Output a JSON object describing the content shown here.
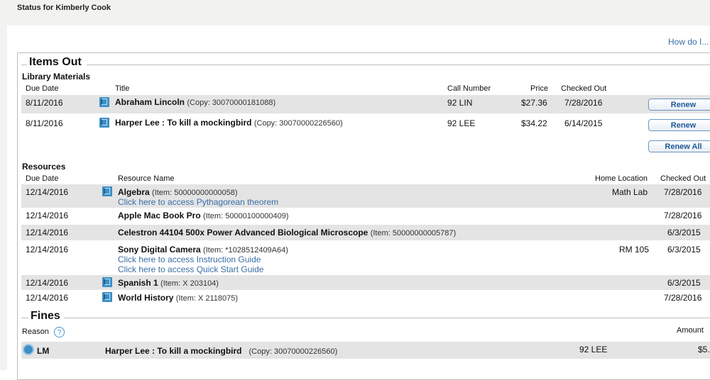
{
  "page": {
    "title": "Status for Kimberly Cook",
    "help_link": "How do I..."
  },
  "items_out": {
    "section_title": "Items Out",
    "subsection": "Library Materials",
    "headers": {
      "due": "Due Date",
      "title": "Title",
      "call": "Call Number",
      "price": "Price",
      "checked": "Checked Out"
    },
    "rows": [
      {
        "due": "8/11/2016",
        "title": "Abraham Lincoln",
        "copy": "(Copy: 30070000181088)",
        "call": "92 LIN",
        "price": "$27.36",
        "checked": "7/28/2016",
        "button": "Renew"
      },
      {
        "due": "8/11/2016",
        "title": "Harper Lee : To kill a mockingbird",
        "copy": "(Copy: 30070000226560)",
        "call": "92 LEE",
        "price": "$34.22",
        "checked": "6/14/2015",
        "button": "Renew"
      }
    ],
    "renew_all": "Renew All"
  },
  "resources": {
    "subsection": "Resources",
    "headers": {
      "due": "Due Date",
      "name": "Resource Name",
      "location": "Home Location",
      "checked": "Checked Out"
    },
    "rows": [
      {
        "due": "12/14/2016",
        "name": "Algebra",
        "item": "(Item: 50000000000058)",
        "location": "Math Lab",
        "checked": "7/28/2016",
        "links": [
          "Click here to access Pythagorean theorem"
        ]
      },
      {
        "due": "12/14/2016",
        "name": "Apple Mac Book Pro",
        "item": "(Item: 50000100000409)",
        "location": "",
        "checked": "7/28/2016",
        "links": []
      },
      {
        "due": "12/14/2016",
        "name": "Celestron 44104 500x Power Advanced Biological Microscope",
        "item": "(Item: 50000000005787)",
        "location": "",
        "checked": "6/3/2015",
        "links": []
      },
      {
        "due": "12/14/2016",
        "name": "Sony Digital Camera",
        "item": "(Item: *1028512409A64)",
        "location": "RM 105",
        "checked": "6/3/2015",
        "links": [
          "Click here to access Instruction Guide",
          "Click here to access Quick Start Guide"
        ]
      },
      {
        "due": "12/14/2016",
        "name": "Spanish 1",
        "item": "(Item: X 203104)",
        "location": "",
        "checked": "6/3/2015",
        "links": []
      },
      {
        "due": "12/14/2016",
        "name": "World History",
        "item": "(Item: X 2118075)",
        "location": "",
        "checked": "7/28/2016",
        "links": []
      }
    ]
  },
  "fines": {
    "section_title": "Fines",
    "headers": {
      "reason": "Reason",
      "amount": "Amount"
    },
    "help_glyph": "?",
    "rows": [
      {
        "reason": "LM",
        "title": "Harper Lee : To kill a mockingbird",
        "copy": "(Copy: 30070000226560)",
        "call": "92 LEE",
        "amount": "$5."
      }
    ]
  },
  "colors": {
    "link": "#3b6fa8",
    "row_shade": "#e4e4e4",
    "icon_blue": "#3d8fc6"
  },
  "icons": {
    "material": "book-icon",
    "help": "question-circle-icon",
    "fine_reason": "lm-icon"
  }
}
